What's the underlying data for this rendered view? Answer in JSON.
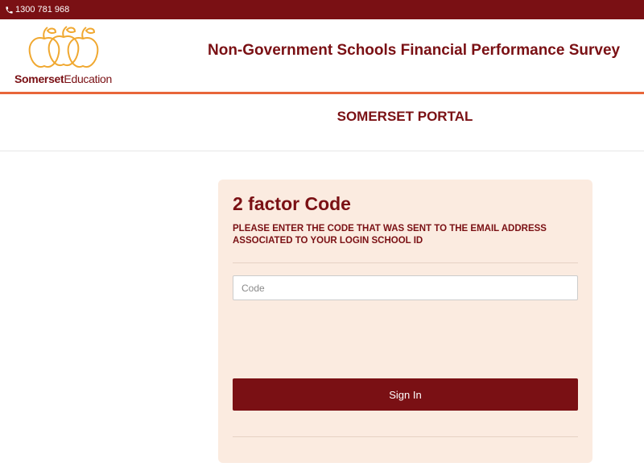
{
  "topbar": {
    "phone": "1300 781 968"
  },
  "header": {
    "logo_bold": "Somerset",
    "logo_regular": "Education",
    "title": "Non-Government Schools Financial Performance Survey"
  },
  "portal": {
    "title": "SOMERSET PORTAL"
  },
  "form": {
    "title": "2 factor Code",
    "subtitle": "PLEASE ENTER THE CODE THAT WAS SENT TO THE EMAIL ADDRESS ASSOCIATED TO YOUR LOGIN SCHOOL ID",
    "code_value": "",
    "code_placeholder": "Code",
    "submit_label": "Sign In"
  },
  "colors": {
    "brand": "#7a1014",
    "accent": "#e8663a",
    "card_bg": "#fbebe0",
    "logo_apple": "#f0a830"
  }
}
